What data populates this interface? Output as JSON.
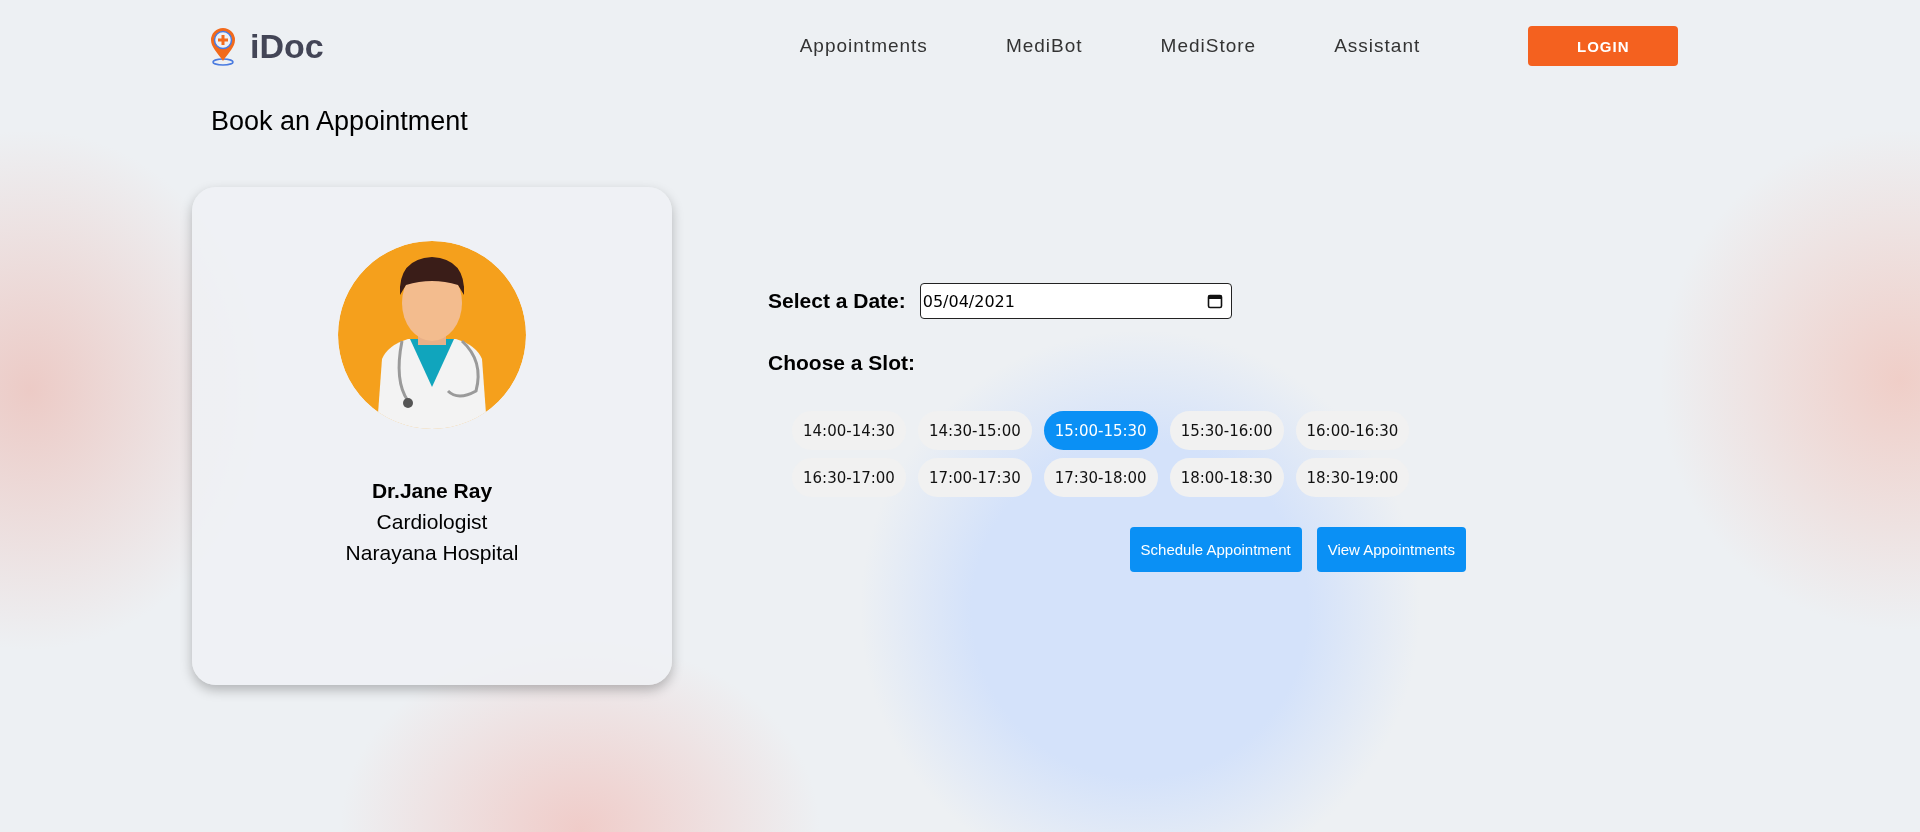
{
  "brand": {
    "name": "iDoc"
  },
  "nav": {
    "links": [
      "Appointments",
      "MediBot",
      "MediStore",
      "Assistant"
    ],
    "login": "LOGIN"
  },
  "page_title": "Book an Appointment",
  "doctor": {
    "name": "Dr.Jane Ray",
    "specialty": "Cardiologist",
    "hospital": "Narayana Hospital"
  },
  "form": {
    "date_label": "Select a Date:",
    "date_value": "05/04/2021",
    "slot_label": "Choose a Slot:",
    "slots": [
      {
        "label": "14:00-14:30",
        "selected": false
      },
      {
        "label": "14:30-15:00",
        "selected": false
      },
      {
        "label": "15:00-15:30",
        "selected": true
      },
      {
        "label": "15:30-16:00",
        "selected": false
      },
      {
        "label": "16:00-16:30",
        "selected": false
      },
      {
        "label": "16:30-17:00",
        "selected": false
      },
      {
        "label": "17:00-17:30",
        "selected": false
      },
      {
        "label": "17:30-18:00",
        "selected": false
      },
      {
        "label": "18:00-18:30",
        "selected": false
      },
      {
        "label": "18:30-19:00",
        "selected": false
      }
    ],
    "buttons": [
      "Schedule Appointment",
      "View Appointments"
    ]
  }
}
